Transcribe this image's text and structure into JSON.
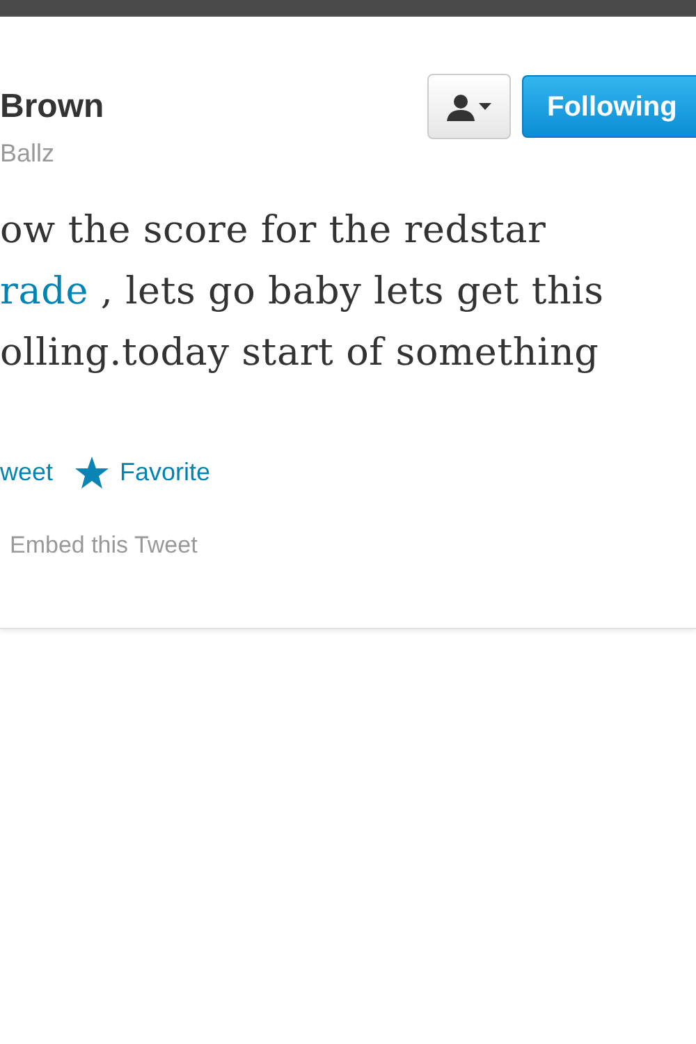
{
  "profile": {
    "name": "Brown",
    "handle": "Ballz"
  },
  "buttons": {
    "person_menu": {
      "kind": "person-dropdown"
    },
    "follow": {
      "label": "Following",
      "selected": true
    }
  },
  "tweet_lines": [
    {
      "segments": [
        {
          "kind": "plain",
          "text": "ow the score for the redstar"
        }
      ]
    },
    {
      "segments": [
        {
          "kind": "link",
          "text": "rade"
        },
        {
          "kind": "plain",
          "text": " , lets go baby lets get this"
        }
      ]
    },
    {
      "segments": [
        {
          "kind": "plain",
          "text": "olling.today start of something"
        }
      ]
    }
  ],
  "actions": [
    {
      "kind": "retweet",
      "label": "weet"
    },
    {
      "kind": "favorite",
      "label": "Favorite"
    }
  ],
  "embed": {
    "label": "Embed this Tweet"
  }
}
